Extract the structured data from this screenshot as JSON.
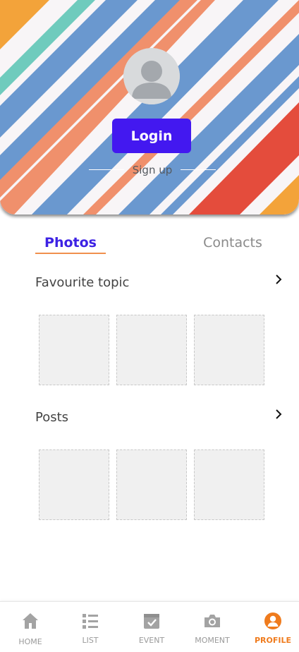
{
  "header": {
    "login_label": "Login",
    "signup_label": "Sign up"
  },
  "tabs": [
    {
      "label": "Photos",
      "active": true
    },
    {
      "label": "Contacts",
      "active": false
    }
  ],
  "sections": [
    {
      "title": "Favourite topic"
    },
    {
      "title": "Posts"
    }
  ],
  "bottom_nav": [
    {
      "label": "HOME",
      "icon": "home-icon",
      "active": false
    },
    {
      "label": "LIST",
      "icon": "list-icon",
      "active": false
    },
    {
      "label": "EVENT",
      "icon": "event-icon",
      "active": false
    },
    {
      "label": "MOMENT",
      "icon": "camera-icon",
      "active": false
    },
    {
      "label": "PROFILE",
      "icon": "profile-icon",
      "active": true
    }
  ],
  "colors": {
    "accent": "#4318f0",
    "tab_active": "#3d22e4",
    "tab_underline": "#f0904d",
    "nav_active": "#ef7b1d",
    "stripe_blue": "#6a98cf",
    "stripe_orange": "#f0906c",
    "stripe_teal": "#6fcbbd",
    "stripe_red": "#e44c3c",
    "stripe_gold": "#f3a33a"
  }
}
